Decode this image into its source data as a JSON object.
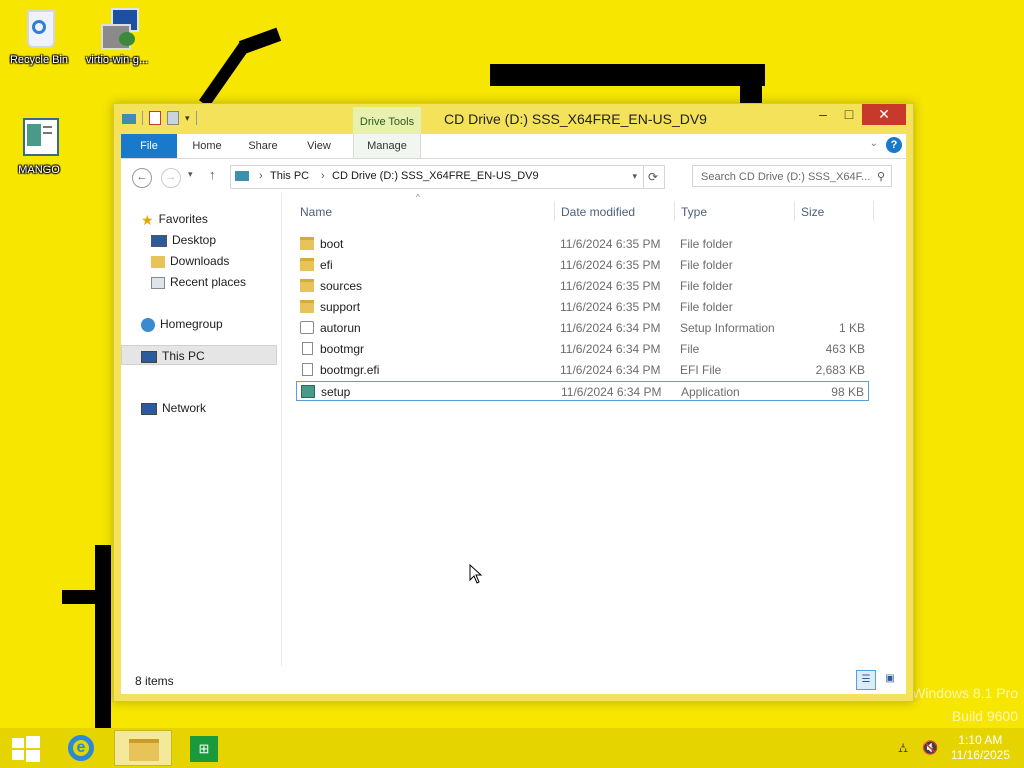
{
  "desktop": {
    "icons": [
      {
        "name": "recycle-bin",
        "label": "Recycle Bin"
      },
      {
        "name": "virtio-installer",
        "label": "virtio-win-g..."
      },
      {
        "name": "mango",
        "label": "MANGO"
      }
    ],
    "watermark": {
      "line1": "Windows 8.1 Pro",
      "line2": "Build 9600"
    }
  },
  "window": {
    "title": "CD Drive (D:) SSS_X64FRE_EN-US_DV9",
    "contextual_tab_group": "Drive Tools",
    "ribbon_tabs": [
      "File",
      "Home",
      "Share",
      "View",
      "Manage"
    ],
    "controls": {
      "minimize": "–",
      "maximize": "□",
      "close": "✕"
    },
    "address": {
      "crumbs": [
        "This PC",
        "CD Drive (D:) SSS_X64FRE_EN-US_DV9"
      ],
      "search_placeholder": "Search CD Drive (D:) SSS_X64F..."
    },
    "nav_pane": {
      "favorites": "Favorites",
      "desktop": "Desktop",
      "downloads": "Downloads",
      "recent": "Recent places",
      "homegroup": "Homegroup",
      "this_pc": "This PC",
      "network": "Network"
    },
    "columns": {
      "name": "Name",
      "date": "Date modified",
      "type": "Type",
      "size": "Size"
    },
    "files": [
      {
        "name": "boot",
        "date": "11/6/2024 6:35 PM",
        "type": "File folder",
        "size": "",
        "icon": "folder-icon"
      },
      {
        "name": "efi",
        "date": "11/6/2024 6:35 PM",
        "type": "File folder",
        "size": "",
        "icon": "folder-icon"
      },
      {
        "name": "sources",
        "date": "11/6/2024 6:35 PM",
        "type": "File folder",
        "size": "",
        "icon": "folder-icon"
      },
      {
        "name": "support",
        "date": "11/6/2024 6:35 PM",
        "type": "File folder",
        "size": "",
        "icon": "folder-icon"
      },
      {
        "name": "autorun",
        "date": "11/6/2024 6:34 PM",
        "type": "Setup Information",
        "size": "1 KB",
        "icon": "settings-file-icon"
      },
      {
        "name": "bootmgr",
        "date": "11/6/2024 6:34 PM",
        "type": "File",
        "size": "463 KB",
        "icon": "file-icon"
      },
      {
        "name": "bootmgr.efi",
        "date": "11/6/2024 6:34 PM",
        "type": "EFI File",
        "size": "2,683 KB",
        "icon": "file-icon"
      },
      {
        "name": "setup",
        "date": "11/6/2024 6:34 PM",
        "type": "Application",
        "size": "98 KB",
        "icon": "application-icon",
        "selected": true
      }
    ],
    "status": {
      "count": "8 items"
    }
  },
  "taskbar": {
    "clock": {
      "time": "1:10 AM",
      "date": "11/16/2025"
    },
    "items": [
      "start-icon",
      "internet-explorer-icon",
      "file-explorer-icon",
      "store-icon"
    ]
  },
  "colors": {
    "desktop_bg": "#f7e600",
    "file_tab": "#1979ca",
    "close_button": "#c7392b",
    "selection_border": "#5aa0d8"
  }
}
